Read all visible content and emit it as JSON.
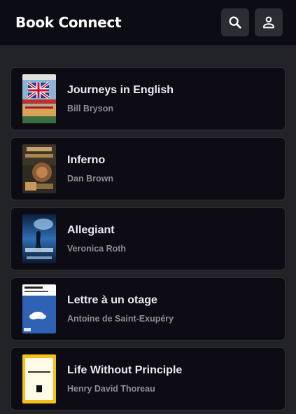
{
  "header": {
    "title": "Book Connect",
    "search_icon": "search-icon",
    "account_icon": "person-icon"
  },
  "books": [
    {
      "title": "Journeys in English",
      "author": "Bill Bryson",
      "cover_colors": [
        "#7fa9c9",
        "#b8322d",
        "#e9d7a5"
      ]
    },
    {
      "title": "Inferno",
      "author": "Dan Brown",
      "cover_colors": [
        "#2f2b23",
        "#7a5a3a",
        "#b8834c"
      ]
    },
    {
      "title": "Allegiant",
      "author": "Veronica Roth",
      "cover_colors": [
        "#0d2847",
        "#3b78c0",
        "#a8d0ee"
      ]
    },
    {
      "title": "Lettre à un otage",
      "author": "Antoine de Saint-Exupéry",
      "cover_colors": [
        "#ffffff",
        "#2f62b5",
        "#e7eef8"
      ]
    },
    {
      "title": "Life Without Principle",
      "author": "Henry David Thoreau",
      "cover_colors": [
        "#f2c11d",
        "#fffbe4",
        "#111111"
      ]
    }
  ]
}
